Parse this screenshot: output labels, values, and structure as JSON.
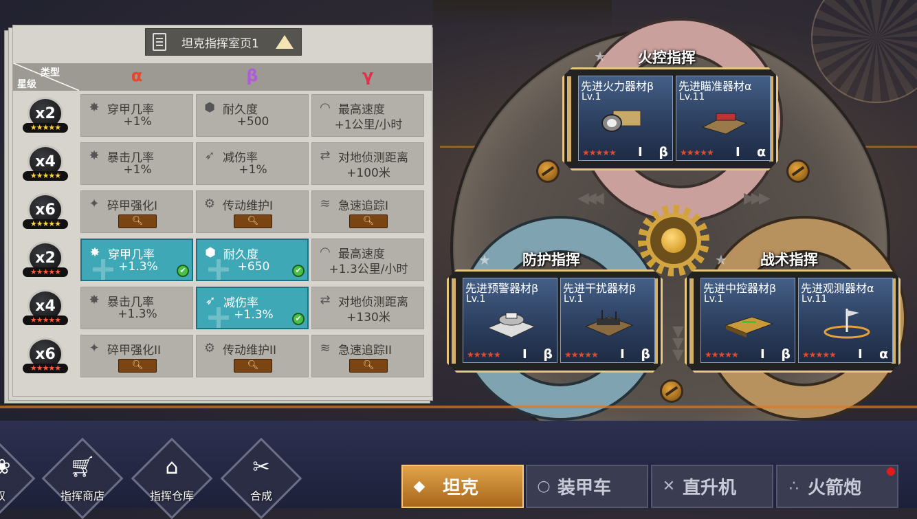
{
  "panel": {
    "page_title": "坦克指挥室页1",
    "header": {
      "type_label": "类型",
      "star_label": "星级",
      "columns": [
        "α",
        "β",
        "γ"
      ]
    },
    "column_colors": [
      "#e5462c",
      "#b25ad8",
      "#e0304a"
    ],
    "rows": [
      {
        "badge": "x2",
        "stars": "★★★★★",
        "star_color": "#ffd24a",
        "cells": [
          {
            "icon": "armor-piercing-icon",
            "glyph": "✸",
            "name": "穿甲几率",
            "value": "+1%",
            "active": false
          },
          {
            "icon": "durability-icon",
            "glyph": "⬢",
            "name": "耐久度",
            "value": "+500",
            "active": false
          },
          {
            "icon": "speedometer-icon",
            "glyph": "◠",
            "name": "最高速度",
            "value": "+1公里/小时",
            "active": false
          }
        ]
      },
      {
        "badge": "x4",
        "stars": "★★★★★",
        "star_color": "#ffd24a",
        "cells": [
          {
            "icon": "critical-hit-icon",
            "glyph": "✸",
            "name": "暴击几率",
            "value": "+1%",
            "active": false
          },
          {
            "icon": "damage-reduction-icon",
            "glyph": "➶",
            "name": "减伤率",
            "value": "+1%",
            "active": false
          },
          {
            "icon": "detection-range-icon",
            "glyph": "⇄",
            "name": "对地侦测距离",
            "value": "+100米",
            "active": false
          }
        ]
      },
      {
        "badge": "x6",
        "stars": "★★★★★",
        "star_color": "#ffd24a",
        "cells": [
          {
            "icon": "armor-shatter-icon",
            "glyph": "✦",
            "name": "碎甲强化I",
            "value": "",
            "locked": true,
            "active": false
          },
          {
            "icon": "transmission-icon",
            "glyph": "⚙",
            "name": "传动维护I",
            "value": "",
            "locked": true,
            "active": false
          },
          {
            "icon": "pursuit-icon",
            "glyph": "≋",
            "name": "急速追踪I",
            "value": "",
            "locked": true,
            "active": false
          }
        ]
      },
      {
        "badge": "x2",
        "stars": "★★★★★",
        "star_color": "#ff5b3c",
        "cells": [
          {
            "icon": "armor-piercing-icon",
            "glyph": "✸",
            "name": "穿甲几率",
            "value": "+1.3%",
            "active": true
          },
          {
            "icon": "durability-icon",
            "glyph": "⬢",
            "name": "耐久度",
            "value": "+650",
            "active": true
          },
          {
            "icon": "speedometer-icon",
            "glyph": "◠",
            "name": "最高速度",
            "value": "+1.3公里/小时",
            "active": false
          }
        ]
      },
      {
        "badge": "x4",
        "stars": "★★★★★",
        "star_color": "#ff5b3c",
        "cells": [
          {
            "icon": "critical-hit-icon",
            "glyph": "✸",
            "name": "暴击几率",
            "value": "+1.3%",
            "active": false
          },
          {
            "icon": "damage-reduction-icon",
            "glyph": "➶",
            "name": "减伤率",
            "value": "+1.3%",
            "active": true
          },
          {
            "icon": "detection-range-icon",
            "glyph": "⇄",
            "name": "对地侦测距离",
            "value": "+130米",
            "active": false
          }
        ]
      },
      {
        "badge": "x6",
        "stars": "★★★★★",
        "star_color": "#ff5b3c",
        "cells": [
          {
            "icon": "armor-shatter-icon",
            "glyph": "✦",
            "name": "碎甲强化II",
            "value": "",
            "locked": true,
            "active": false
          },
          {
            "icon": "transmission-icon",
            "glyph": "⚙",
            "name": "传动维护II",
            "value": "",
            "locked": true,
            "active": false
          },
          {
            "icon": "pursuit-icon",
            "glyph": "≋",
            "name": "急速追踪II",
            "value": "",
            "locked": true,
            "active": false
          }
        ]
      }
    ]
  },
  "commands": {
    "fire": {
      "title": "火控指挥",
      "items": [
        {
          "name": "先进火力器材β",
          "level": "Lv.1",
          "rank": "I",
          "greek": "β"
        },
        {
          "name": "先进瞄准器材α",
          "level": "Lv.11",
          "rank": "I",
          "greek": "α"
        }
      ]
    },
    "defense": {
      "title": "防护指挥",
      "items": [
        {
          "name": "先进预警器材β",
          "level": "Lv.1",
          "rank": "I",
          "greek": "β"
        },
        {
          "name": "先进干扰器材β",
          "level": "Lv.1",
          "rank": "I",
          "greek": "β"
        }
      ]
    },
    "tactic": {
      "title": "战术指挥",
      "items": [
        {
          "name": "先进中控器材β",
          "level": "Lv.1",
          "rank": "I",
          "greek": "β"
        },
        {
          "name": "先进观测器材α",
          "level": "Lv.11",
          "rank": "I",
          "greek": "α"
        }
      ]
    },
    "item_stars": "★★★★★"
  },
  "bottom_nav": {
    "partial_label": "双",
    "shop": "指挥商店",
    "warehouse": "指挥仓库",
    "synthesis": "合成"
  },
  "tabs": [
    {
      "label": "坦克",
      "icon": "◆",
      "selected": true
    },
    {
      "label": "装甲车",
      "icon": "○",
      "selected": false
    },
    {
      "label": "直升机",
      "icon": "✕",
      "selected": false
    },
    {
      "label": "火箭炮",
      "icon": "∴",
      "selected": false,
      "notify": true
    }
  ]
}
